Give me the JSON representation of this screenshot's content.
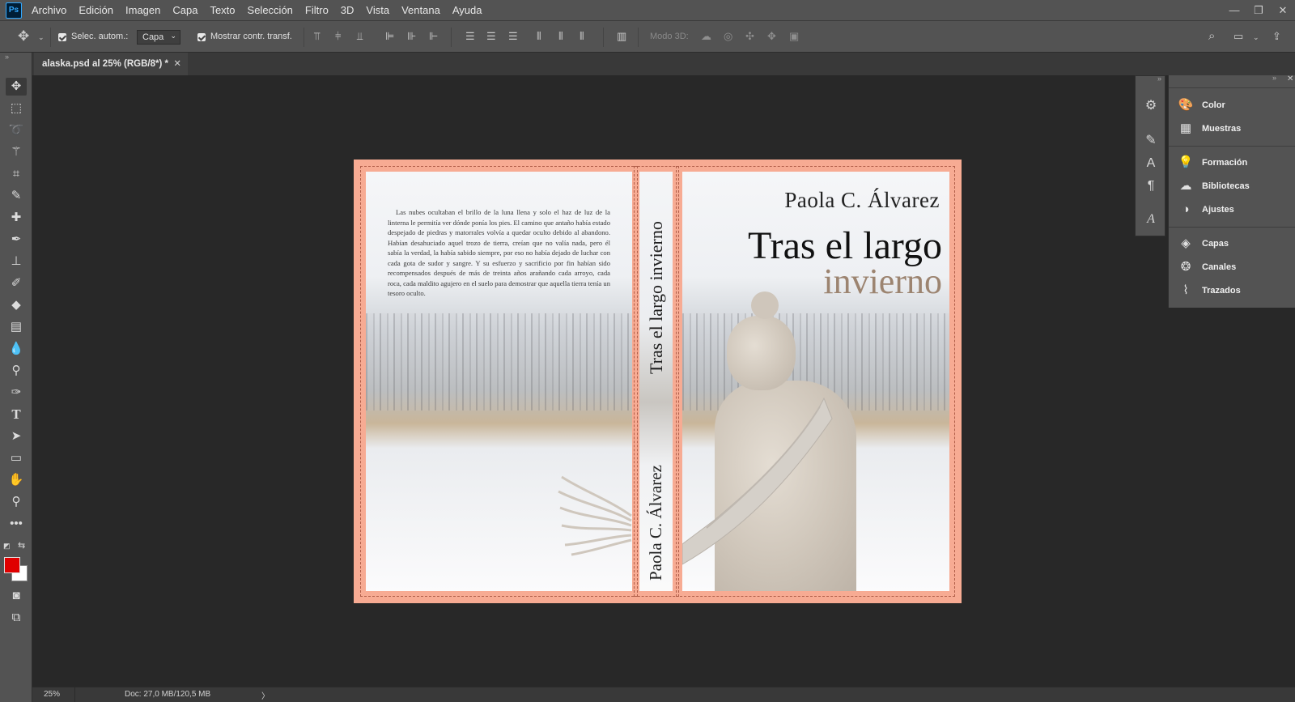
{
  "app": {
    "logo": "Ps"
  },
  "menu": [
    "Archivo",
    "Edición",
    "Imagen",
    "Capa",
    "Texto",
    "Selección",
    "Filtro",
    "3D",
    "Vista",
    "Ventana",
    "Ayuda"
  ],
  "window_controls": {
    "minimize": "—",
    "restore": "❐",
    "close": "✕"
  },
  "options": {
    "auto_select_label": "Selec. autom.:",
    "auto_select_value": "Capa",
    "show_transform_label": "Mostrar contr. transf.",
    "mode3d_label": "Modo 3D:"
  },
  "document_tab": {
    "title": "alaska.psd al 25% (RGB/8*) *",
    "close": "✕"
  },
  "cover": {
    "back_blurb": "Las nubes ocultaban el brillo de la luna llena y solo el haz de luz de la linterna le permitía ver dónde ponía los pies. El camino que antaño había estado despejado de piedras y matorrales volvía a quedar oculto debido al abandono. Habían desahuciado aquel trozo de tierra, creían que no valía nada, pero él sabía la verdad, la había sabido siempre, por eso no había dejado de luchar con cada gota de sudor y sangre. Y su esfuerzo y sacrificio por fin habían sido recompensados después de más de treinta años arañando cada arroyo, cada roca, cada maldito agujero en el suelo para demostrar que aquella tierra tenía un tesoro oculto.",
    "spine_title": "Tras el largo invierno",
    "spine_author": "Paola C. Álvarez",
    "front_author": "Paola C. Álvarez",
    "front_title_line1": "Tras el largo",
    "front_title_line2": "invierno"
  },
  "right_panel": {
    "items": [
      {
        "label": "Color",
        "icon": "palette-icon"
      },
      {
        "label": "Muestras",
        "icon": "grid-icon"
      },
      {
        "label": "Formación",
        "icon": "bulb-icon"
      },
      {
        "label": "Bibliotecas",
        "icon": "library-icon"
      },
      {
        "label": "Ajustes",
        "icon": "adjust-icon"
      },
      {
        "label": "Capas",
        "icon": "layers-icon"
      },
      {
        "label": "Canales",
        "icon": "channels-icon"
      },
      {
        "label": "Trazados",
        "icon": "paths-icon"
      }
    ]
  },
  "status": {
    "zoom": "25%",
    "doc": "Doc: 27,0 MB/120,5 MB",
    "arrow": "〉"
  },
  "colors": {
    "foreground": "#e00000",
    "background": "#ffffff",
    "bleed": "#f7ab93"
  }
}
